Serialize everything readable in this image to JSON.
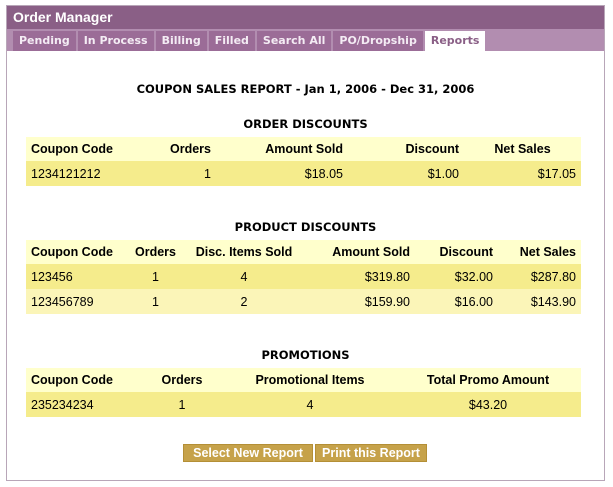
{
  "window": {
    "title": "Order Manager"
  },
  "tabs": [
    {
      "label": "Pending"
    },
    {
      "label": "In Process"
    },
    {
      "label": "Billing"
    },
    {
      "label": "Filled"
    },
    {
      "label": "Search All"
    },
    {
      "label": "PO/Dropship"
    },
    {
      "label": "Reports",
      "active": true
    }
  ],
  "report": {
    "title": "COUPON SALES REPORT - Jan 1, 2006 - Dec 31, 2006",
    "order_discounts": {
      "heading": "ORDER DISCOUNTS",
      "columns": [
        "Coupon Code",
        "Orders",
        "Amount Sold",
        "Discount",
        "Net Sales"
      ],
      "rows": [
        [
          "1234121212",
          "1",
          "$18.05",
          "$1.00",
          "$17.05"
        ]
      ]
    },
    "product_discounts": {
      "heading": "PRODUCT DISCOUNTS",
      "columns": [
        "Coupon Code",
        "Orders",
        "Disc. Items Sold",
        "Amount Sold",
        "Discount",
        "Net Sales"
      ],
      "rows": [
        [
          "123456",
          "1",
          "4",
          "$319.80",
          "$32.00",
          "$287.80"
        ],
        [
          "123456789",
          "1",
          "2",
          "$159.90",
          "$16.00",
          "$143.90"
        ]
      ]
    },
    "promotions": {
      "heading": "PROMOTIONS",
      "columns": [
        "Coupon Code",
        "Orders",
        "Promotional Items",
        "Total Promo Amount"
      ],
      "rows": [
        [
          "235234234",
          "1",
          "4",
          "$43.20"
        ]
      ]
    }
  },
  "buttons": {
    "select_new_report": "Select New Report",
    "print_report": "Print this Report"
  },
  "colors": {
    "titlebar": "#8a5f86",
    "tabbar": "#b28db0",
    "tab": "#9b6c97",
    "header_row": "#ffffcc",
    "row_odd": "#f5ec8c",
    "row_even": "#fbf5b8",
    "button": "#c6a24a"
  }
}
